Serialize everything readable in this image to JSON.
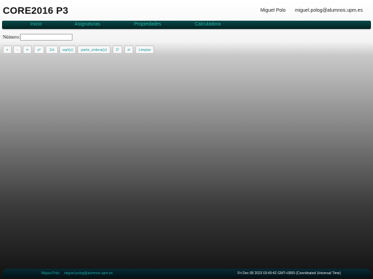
{
  "header": {
    "title": "CORE2016 P3",
    "user_name": "Miguel Polo",
    "user_email": "miguel.polog@alumnos.upm.es"
  },
  "nav": {
    "items": [
      {
        "label": "Inicio"
      },
      {
        "label": "Asignaturas"
      },
      {
        "label": "Propiedades"
      },
      {
        "label": "Calculadora"
      }
    ]
  },
  "calculator": {
    "number_label": "Número:",
    "number_value": "",
    "operations": [
      {
        "label": "+"
      },
      {
        "label": "-"
      },
      {
        "label": "="
      },
      {
        "label": "x²"
      },
      {
        "label": "1/x"
      },
      {
        "label": "sqrt(x)"
      },
      {
        "label": "parte_entera(x)"
      },
      {
        "label": "2ˣ"
      },
      {
        "label": "x!"
      },
      {
        "label": "Limpiar"
      }
    ]
  },
  "footer": {
    "name": "Miguel Polo",
    "email": "miguel.polog@alumnos.upm.es",
    "datetime": "Fri Dec 08 2023 03:49:42 GMT+0000 (Coordinated Universal Time)"
  },
  "colors": {
    "accent": "#26b3a7",
    "nav_bg": "#0b4b4b",
    "footer_bg": "#062b35"
  }
}
